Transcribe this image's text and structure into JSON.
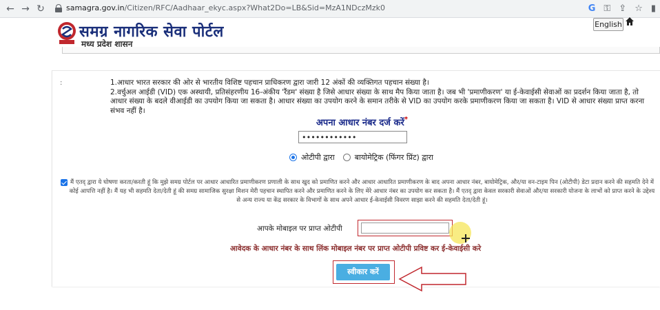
{
  "browser": {
    "url_host": "samagra.gov.in",
    "url_path": "/Citizen/RFC/Aadhaar_ekyc.aspx?What2Do=LB&Sid=MzA1NDczMzk0",
    "icons": [
      "back-arrow",
      "forward-arrow",
      "reload",
      "lock",
      "google",
      "key",
      "share",
      "star",
      "sidebar"
    ]
  },
  "header": {
    "title": "समग्र नागरिक सेवा पोर्टल",
    "subtitle": "मध्य प्रदेश शासन",
    "language_button": "English",
    "home_icon": "home-icon"
  },
  "info": {
    "bullet": ":",
    "line1": "1.आधार भारत सरकार की ओर से भारतीय विशिष्ट पहचान प्राधिकरण द्वारा जारी 12 अंकों की व्यक्तिगत पहचान संख्या है।",
    "line2": "2.वर्चुअल आईडी (VID) एक अस्थायी, प्रतिसंहरणीय 16-अंकीय 'रैंडम' संख्या है जिसे आधार संख्या के साथ मैप किया जाता है। जब भी 'प्रमाणीकरण' या ई-केवाईसी सेवाओं का प्रदर्शन किया जाता है, तो आधार संख्या के बदले वीआईडी का उपयोग किया जा सकता है। आधार संख्या का उपयोग करने के समान तरीके से VID का उपयोग करके प्रमाणीकरण किया जा सकता है। VID से आधार संख्या प्राप्त करना संभव नहीं है।"
  },
  "aadhaar": {
    "heading": "अपना आधार नंबर दर्ज करें",
    "required_mark": "*",
    "value": "••••••••••••"
  },
  "auth_method": {
    "options": [
      {
        "label": "ओटीपी द्वारा",
        "checked": true
      },
      {
        "label": "बायोमेट्रिक (फिंगर प्रिंट) द्वारा",
        "checked": false
      }
    ]
  },
  "consent": {
    "checked": true,
    "text": "मैं एतद् द्वारा ये घोषणा करता/करती हूं कि मुझे समग्र पोर्टल पर आधार आधारित प्रमाणीकरण प्रणाली के साथ खुद को प्रमाणित करने और आधार आधारित प्रमाणीकरण के बाद अपना आधार नंबर, बायोमेट्रिक, और/या वन-टाइम पिन (ओटीपी) डेटा प्रदान करने की सहमति देने में कोई आपत्ति नहीं है। मैं यह भी सहमति देता/देती हूं की समग्र सामाजिक सुरक्षा मिशन मेरी पहचान स्थापित करने और प्रमाणित करने के लिए मेरे आधार नंबर का उपयोग कर सकता है। मैं एतद् द्वारा केवल सरकारी सेवाओं और/या सरकारी योजना के लाभों को प्राप्त करने के उद्देश्य से अन्य राज्य या केंद्र सरकार के विभागों के साथ अपने आधार ई-केवाईसी विवरण साझा करने की सहमति देता/देती हूं।"
  },
  "otp": {
    "label": "आपके मोबाइल पर प्राप्त ओटीपी",
    "value": ""
  },
  "note": "आवेदक के आधार नंबर के साथ लिंक मोबाइल नंबर पर प्राप्त ओटीपी प्रविष्ट कर ई-केवाईसी करे",
  "submit_label": "स्वीकार करें",
  "colors": {
    "brand_blue": "#1a2f7a",
    "accent_red": "#c0272d",
    "button_blue": "#4aaee2",
    "note_brown": "#8b2e2e",
    "highlight_yellow": "#f6e65a"
  }
}
